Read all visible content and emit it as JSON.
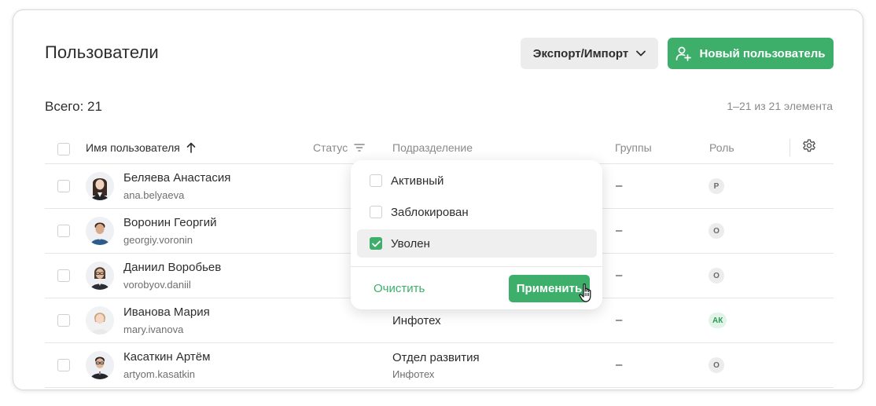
{
  "header": {
    "title": "Пользователи",
    "export_label": "Экспорт/Импорт",
    "new_user_label": "Новый пользователь"
  },
  "summary": {
    "total": "Всего: 21",
    "range": "1–21 из 21 элемента"
  },
  "table": {
    "columns": {
      "name": "Имя пользователя",
      "status": "Статус",
      "department": "Подразделение",
      "groups": "Группы",
      "role": "Роль"
    },
    "rows": [
      {
        "name": "Беляева Анастасия",
        "login": "ana.belyaeva",
        "department": "",
        "department_sub": "",
        "groups": "–",
        "role": "Р"
      },
      {
        "name": "Воронин Георгий",
        "login": "georgiy.voronin",
        "department": "",
        "department_sub": "",
        "groups": "–",
        "role": "О"
      },
      {
        "name": "Даниил Воробьев",
        "login": "vorobyov.daniil",
        "department": "",
        "department_sub": "",
        "groups": "–",
        "role": "О"
      },
      {
        "name": "Иванова Мария",
        "login": "mary.ivanova",
        "department": "Инфотех",
        "department_sub": "",
        "groups": "–",
        "role": "АК"
      },
      {
        "name": "Касаткин Артём",
        "login": "artyom.kasatkin",
        "department": "Отдел развития",
        "department_sub": "Инфотех",
        "groups": "–",
        "role": "О"
      }
    ]
  },
  "status_filter": {
    "options": [
      {
        "label": "Активный",
        "checked": false
      },
      {
        "label": "Заблокирован",
        "checked": false
      },
      {
        "label": "Уволен",
        "checked": true
      }
    ],
    "clear_label": "Очистить",
    "apply_label": "Применить"
  },
  "colors": {
    "accent": "#3daf6a",
    "badge_green_bg": "#e2f4e8",
    "badge_gray_bg": "#ececec"
  },
  "icons": {
    "export_dropdown": "chevron-down-icon",
    "new_user": "user-plus-icon",
    "sort": "arrow-up-icon",
    "filter": "filter-icon",
    "settings": "gear-icon",
    "cursor": "hand-pointer-icon"
  }
}
